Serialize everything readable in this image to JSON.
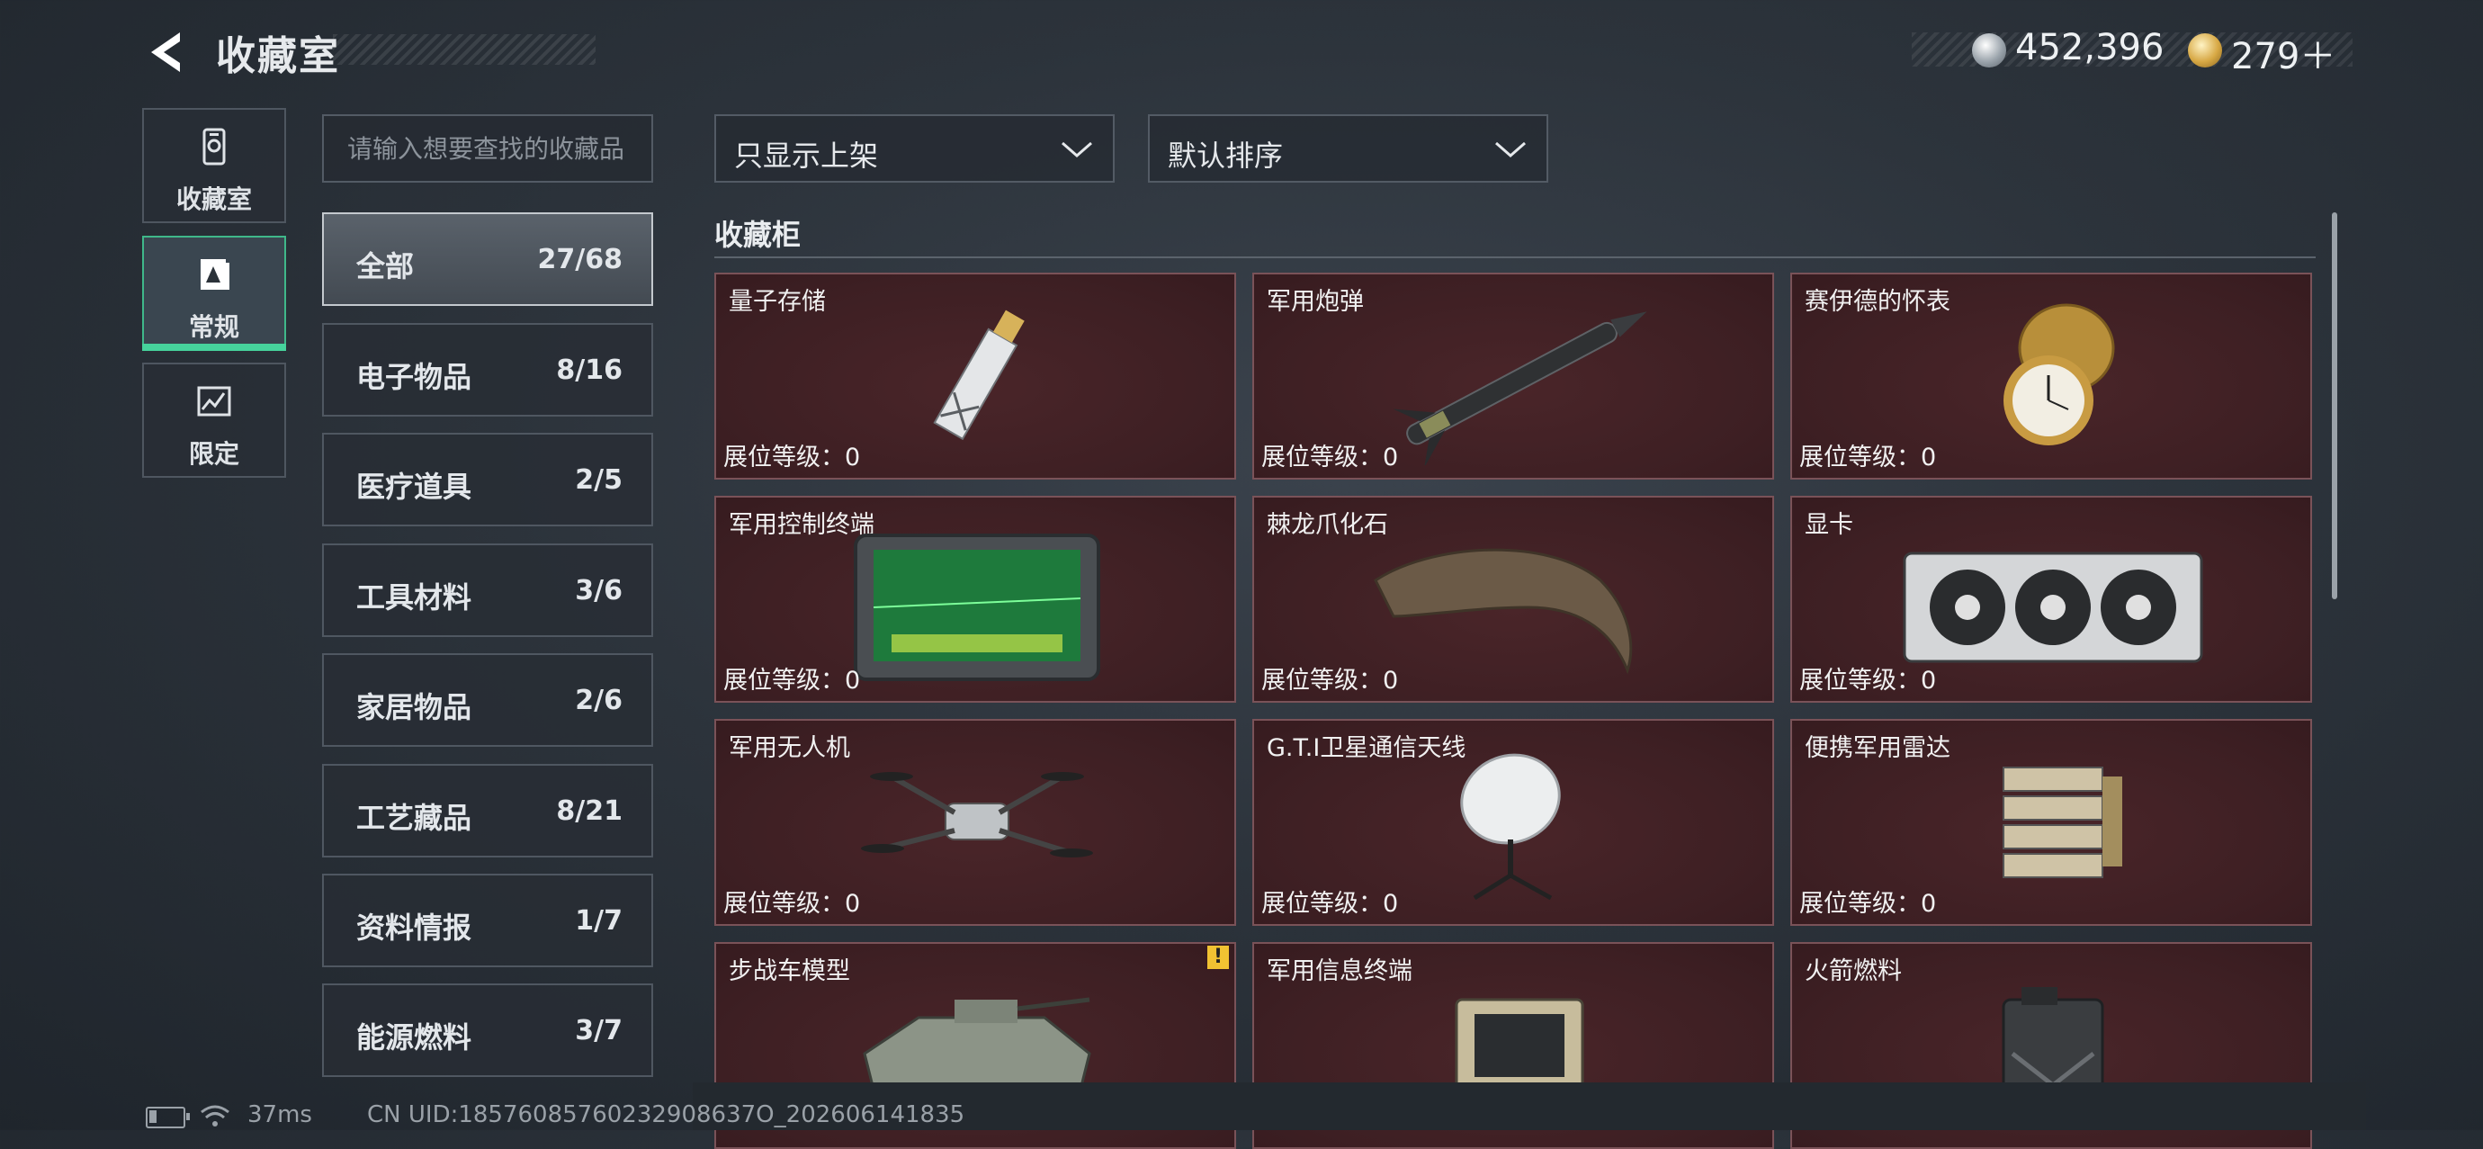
{
  "header": {
    "title": "收藏室",
    "currencies": [
      {
        "icon": "silver-coin-icon",
        "value": "452,396"
      },
      {
        "icon": "gold-triangle-coin-icon",
        "value": "279＋"
      }
    ]
  },
  "side_tabs": [
    {
      "label": "收藏室",
      "icon": "collection-room-icon"
    },
    {
      "label": "常规",
      "icon": "regular-icon",
      "active": true
    },
    {
      "label": "限定",
      "icon": "limited-icon"
    }
  ],
  "search": {
    "placeholder": "请输入想要查找的收藏品"
  },
  "categories": [
    {
      "name": "全部",
      "count": "27/68",
      "active": true
    },
    {
      "name": "电子物品",
      "count": "8/16"
    },
    {
      "name": "医疗道具",
      "count": "2/5"
    },
    {
      "name": "工具材料",
      "count": "3/6"
    },
    {
      "name": "家居物品",
      "count": "2/6"
    },
    {
      "name": "工艺藏品",
      "count": "8/21"
    },
    {
      "name": "资料情报",
      "count": "1/7"
    },
    {
      "name": "能源燃料",
      "count": "3/7"
    }
  ],
  "filters": {
    "display": "只显示上架",
    "sort": "默认排序"
  },
  "shelf": {
    "title": "收藏柜",
    "items": [
      {
        "name": "量子存储",
        "level": "展位等级：0"
      },
      {
        "name": "军用炮弹",
        "level": "展位等级：0"
      },
      {
        "name": "赛伊德的怀表",
        "level": "展位等级：0"
      },
      {
        "name": "军用控制终端",
        "level": "展位等级：0"
      },
      {
        "name": "棘龙爪化石",
        "level": "展位等级：0"
      },
      {
        "name": "显卡",
        "level": "展位等级：0"
      },
      {
        "name": "军用无人机",
        "level": "展位等级：0"
      },
      {
        "name": "G.T.I卫星通信天线",
        "level": "展位等级：0"
      },
      {
        "name": "便携军用雷达",
        "level": "展位等级：0"
      },
      {
        "name": "步战车模型",
        "level": "",
        "warning": "!"
      },
      {
        "name": "军用信息终端",
        "level": ""
      },
      {
        "name": "火箭燃料",
        "level": ""
      }
    ]
  },
  "status_bar": {
    "ping": "37ms",
    "uid": "CN UID:18576085760232908637O_202606141835"
  },
  "colors": {
    "accent": "#46d39c",
    "card_bg": "#3d1f23",
    "card_border": "#7a5258"
  }
}
